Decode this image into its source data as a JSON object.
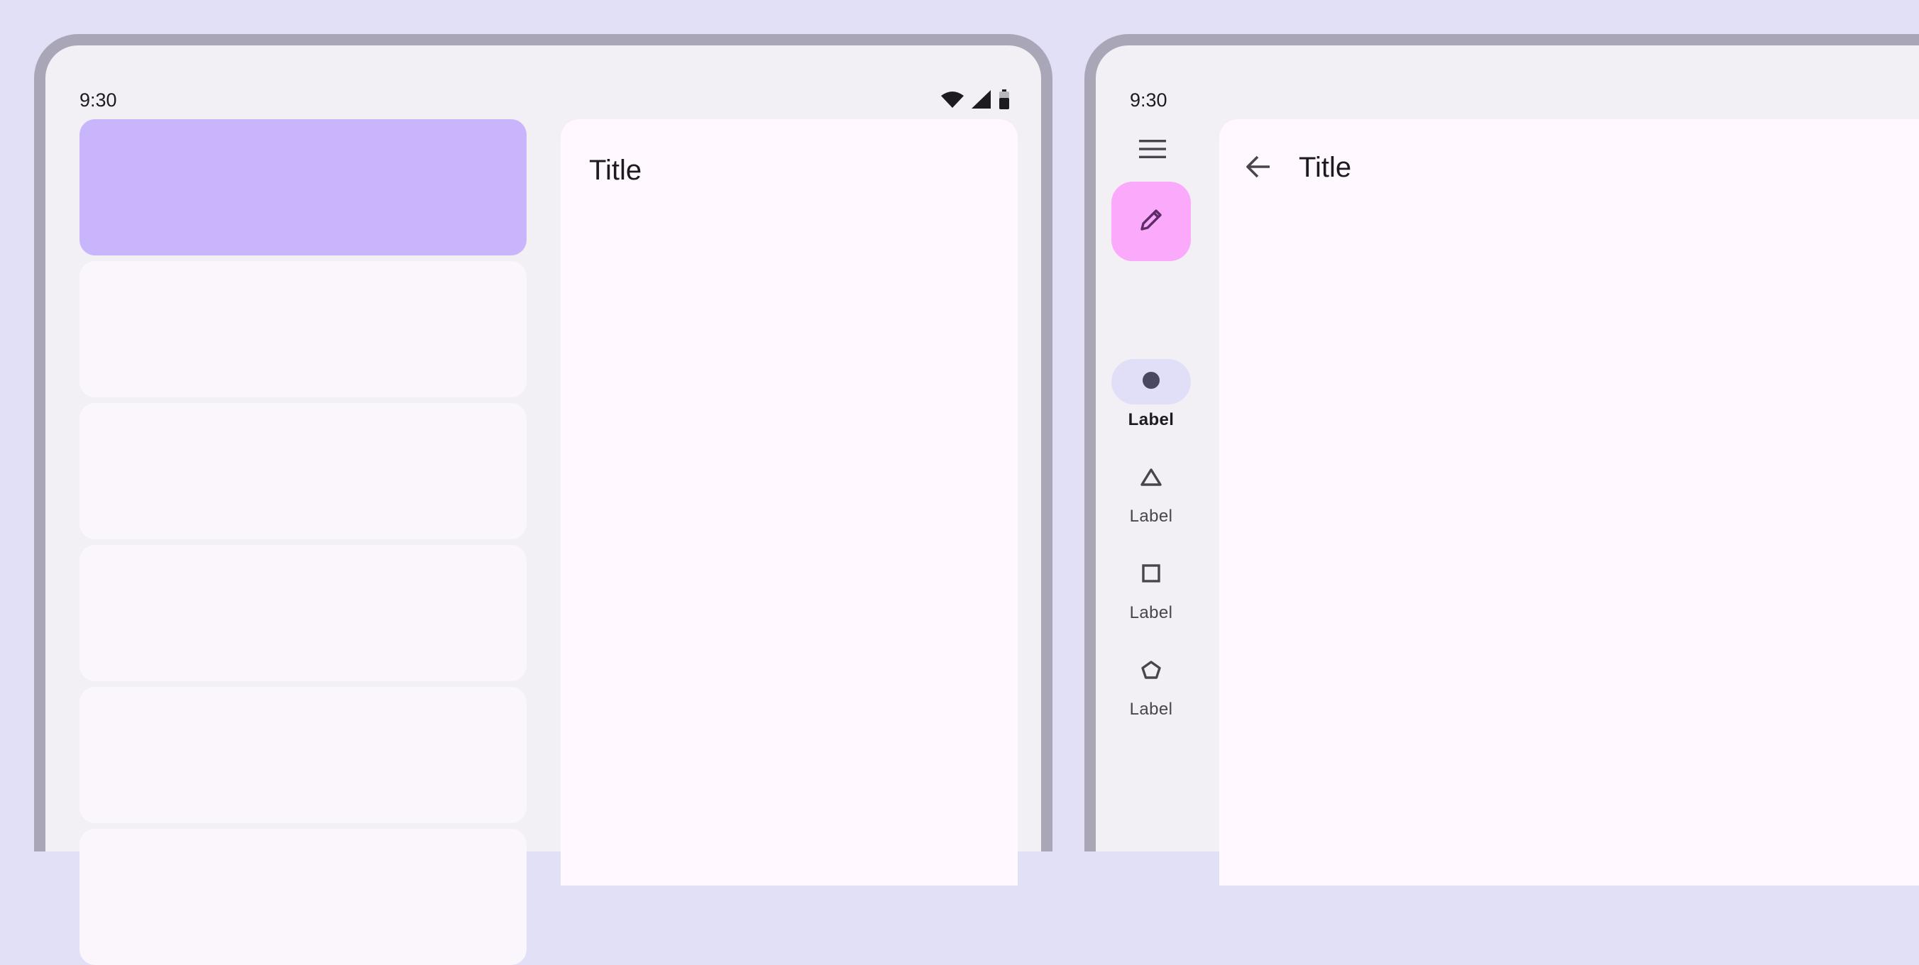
{
  "left_device": {
    "status": {
      "time": "9:30"
    },
    "detail": {
      "title": "Title"
    },
    "list": {
      "selected_index": 0
    }
  },
  "right_device": {
    "status": {
      "time": "9:30"
    },
    "header": {
      "title": "Title"
    },
    "rail": {
      "items": [
        {
          "label": "Label",
          "icon": "circle-icon",
          "active": true
        },
        {
          "label": "Label",
          "icon": "triangle-icon",
          "active": false
        },
        {
          "label": "Label",
          "icon": "square-icon",
          "active": false
        },
        {
          "label": "Label",
          "icon": "pentagon-icon",
          "active": false
        }
      ]
    }
  },
  "colors": {
    "background": "#e2e0f7",
    "device_frame": "#a9a7b7",
    "surface": "#f2eff5",
    "selected_card": "#c8b5fb",
    "card": "#fbf6fc",
    "pane": "#fff8fe",
    "fab": "#faa9fb",
    "rail_indicator": "#e1dff8"
  }
}
